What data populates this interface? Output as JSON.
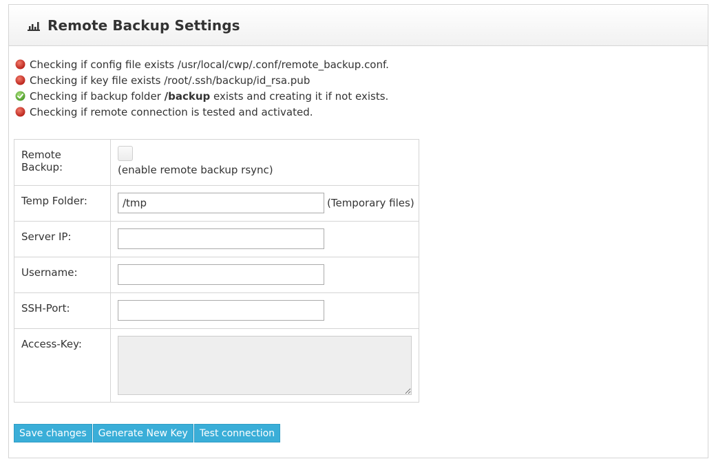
{
  "panel": {
    "title": "Remote Backup Settings",
    "icon": "bar-chart-icon"
  },
  "checks": [
    {
      "status": "fail",
      "icon": "red-dot-icon",
      "text": "Checking if config file exists /usr/local/cwp/.conf/remote_backup.conf."
    },
    {
      "status": "fail",
      "icon": "red-dot-icon",
      "text": "Checking if key file exists /root/.ssh/backup/id_rsa.pub"
    },
    {
      "status": "ok",
      "icon": "green-check-icon",
      "text_before": "Checking if backup folder ",
      "text_bold": "/backup",
      "text_after": " exists and creating it if not exists."
    },
    {
      "status": "fail",
      "icon": "red-dot-icon",
      "text": "Checking if remote connection is tested and activated."
    }
  ],
  "form": {
    "remote_backup": {
      "label": "Remote Backup:",
      "checked": false,
      "hint": "(enable remote backup rsync)"
    },
    "temp_folder": {
      "label": "Temp Folder:",
      "value": "/tmp",
      "suffix": "(Temporary files)"
    },
    "server_ip": {
      "label": "Server IP:",
      "value": ""
    },
    "username": {
      "label": "Username:",
      "value": ""
    },
    "ssh_port": {
      "label": "SSH-Port:",
      "value": ""
    },
    "access_key": {
      "label": "Access-Key:",
      "value": ""
    }
  },
  "buttons": {
    "save": "Save changes",
    "generate": "Generate New Key",
    "test": "Test connection"
  },
  "colors": {
    "button_bg": "#3aaed8",
    "fail": "#c9302c",
    "ok": "#5cb85c"
  }
}
